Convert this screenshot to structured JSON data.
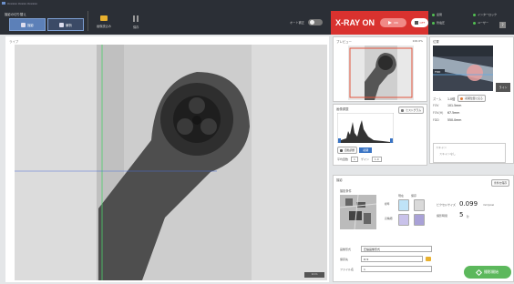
{
  "titlebar": {
    "app_title": "Xxxxxx Xxxxx Xxxxxx"
  },
  "toolbar": {
    "mode_label": "撮影の切り替え",
    "mode_buttons": [
      {
        "label": "撮影"
      },
      {
        "label": "解析"
      }
    ],
    "load_label": "画像読込み",
    "pause_label": "保存",
    "auto_fix_label": "オート補正"
  },
  "xray": {
    "title": "X-RAY ON",
    "on_label": "ON",
    "off_label": "OFF"
  },
  "status": {
    "items": [
      "扉閉",
      "インターロック",
      "管電圧",
      "ユーザー"
    ],
    "help_icon": "?"
  },
  "viewer": {
    "label": "ライブ",
    "scale_label": "1mm"
  },
  "preview": {
    "title": "プレビュー",
    "zoom": "100.0%"
  },
  "position": {
    "title": "位置",
    "side_btn": "ライン",
    "rows": [
      {
        "key": "ズーム",
        "value": "1.0倍",
        "button": "初期位置に戻る"
      },
      {
        "key": "FOV",
        "value": "101.5mm"
      },
      {
        "key": "FOV(H)",
        "value": "67.5mm"
      },
      {
        "key": "FDD",
        "value": "550.0mm"
      }
    ],
    "scan_title": "スキャン",
    "scan_value": "スキャンなし"
  },
  "histogram": {
    "title": "画像調整",
    "histogram_btn": "ヒストグラム",
    "auto_btn": "自動調整",
    "reset_btn": "初期",
    "fields": {
      "label1": "平均回数",
      "value1": "1",
      "label2": "ゲイン",
      "value2": "1.0"
    }
  },
  "capture": {
    "title": "撮影",
    "save_btn": "条件を保存",
    "conditions_label": "撮影条件",
    "head": [
      "現在",
      "保存"
    ],
    "row_labels": [
      "標準",
      "高精細"
    ],
    "pixel_size_key": "ピクセルサイズ",
    "pixel_size_val": "0.099",
    "pixel_size_unit": "mm/pixel",
    "time_key": "撮影時間",
    "time_val": "5",
    "time_unit": "秒",
    "fields": [
      {
        "label": "画像形式",
        "value": "圧縮画像形式"
      },
      {
        "label": "保存先",
        "value": "D:¥"
      },
      {
        "label": "ファイル名",
        "value": "1"
      }
    ],
    "start_btn": "撮影開始"
  }
}
